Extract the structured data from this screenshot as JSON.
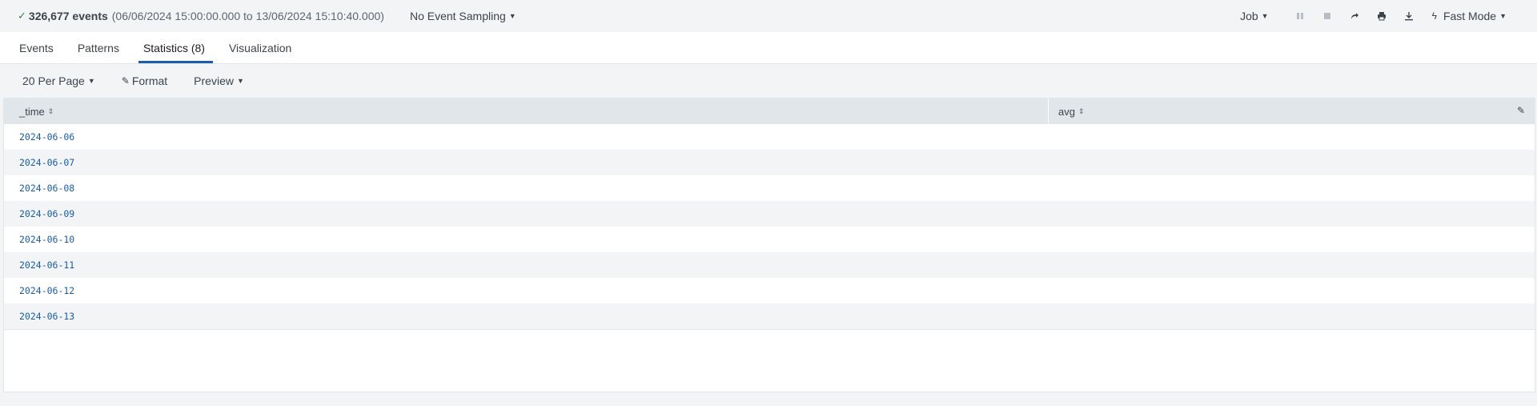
{
  "status": {
    "check_icon": "check-icon",
    "count": "326,677 events",
    "range": "(06/06/2024 15:00:00.000 to 13/06/2024 15:10:40.000)",
    "sampling": "No Event Sampling"
  },
  "job": {
    "label": "Job",
    "mode": "Fast Mode"
  },
  "tabs": [
    {
      "label": "Events"
    },
    {
      "label": "Patterns"
    },
    {
      "label": "Statistics (8)"
    },
    {
      "label": "Visualization"
    }
  ],
  "toolbar": {
    "per_page": "20 Per Page",
    "format": "Format",
    "preview": "Preview"
  },
  "table": {
    "columns": [
      "_time",
      "avg"
    ],
    "rows": [
      {
        "time": "2024-06-06",
        "avg": ""
      },
      {
        "time": "2024-06-07",
        "avg": ""
      },
      {
        "time": "2024-06-08",
        "avg": ""
      },
      {
        "time": "2024-06-09",
        "avg": ""
      },
      {
        "time": "2024-06-10",
        "avg": ""
      },
      {
        "time": "2024-06-11",
        "avg": ""
      },
      {
        "time": "2024-06-12",
        "avg": ""
      },
      {
        "time": "2024-06-13",
        "avg": ""
      }
    ]
  },
  "colors": {
    "accent": "#1a5da6",
    "success": "#2c8a3f"
  }
}
